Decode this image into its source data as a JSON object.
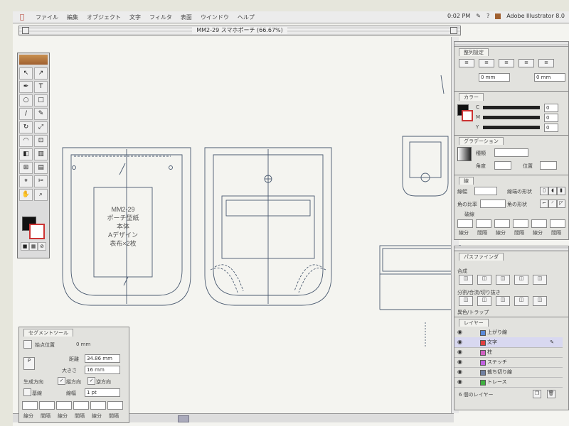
{
  "menubar": {
    "items": [
      "ファイル",
      "編集",
      "オブジェクト",
      "文字",
      "フィルタ",
      "表面",
      "ウインドウ",
      "ヘルプ"
    ],
    "clock": "0:02 PM",
    "app_name": "Adobe Illustrator 8.0"
  },
  "document": {
    "title": "MM2-29 スマホポーチ (66.67%)"
  },
  "drawing": {
    "piece1_lines": [
      "MM2-29",
      "ポーチ型紙",
      "本体",
      "Aデザイン",
      "表布×2枚"
    ]
  },
  "panels": {
    "align": {
      "tab": "整列設定",
      "value1": "0 mm",
      "value2": "0 mm"
    },
    "color": {
      "tab": "カラー",
      "c_label": "C",
      "m_label": "M",
      "y_label": "Y",
      "c_val": "0",
      "m_val": "0",
      "y_val": "0"
    },
    "gradient": {
      "tab": "グラデーション",
      "type_label": "種類",
      "angle_label": "角度",
      "position_label": "位置"
    },
    "stroke": {
      "tab": "線",
      "weight_label": "線幅",
      "miter_label": "角の比率",
      "cap_label": "線端の形状",
      "corner_label": "角の形状",
      "dash_label": "破線",
      "field_labels": [
        "線分",
        "間隔",
        "線分",
        "間隔",
        "線分",
        "間隔"
      ]
    },
    "pathfinder": {
      "tab": "パスファインダ",
      "row1_label": "合成",
      "row2_label": "分割/合流/切り抜き",
      "row3_label": "異色/トラップ"
    },
    "layers": {
      "tab": "レイヤー",
      "rows": [
        {
          "name": "上がり線",
          "color": "#5a8ad8"
        },
        {
          "name": "文字",
          "color": "#e04040"
        },
        {
          "name": "柱",
          "color": "#d060c0"
        },
        {
          "name": "ステッチ",
          "color": "#c060e0"
        },
        {
          "name": "裁ち切り線",
          "color": "#7080a0"
        },
        {
          "name": "トレース",
          "color": "#40b040"
        }
      ],
      "footer": "6 個のレイヤー"
    },
    "segment": {
      "tab": "セグメントツール",
      "start_label": "始点位置",
      "start_value": "0 mm",
      "distance_label": "距離",
      "distance_value": "34.86 mm",
      "size_label": "大きさ",
      "size_value": "16 mm",
      "direction_label": "生成方向",
      "dir_vertical": "縦方向",
      "dir_horizontal": "逆方向",
      "group_label": "基線",
      "weight_label": "線幅",
      "weight_value": "1 pt",
      "field_labels": [
        "線分",
        "間隔",
        "線分",
        "間隔",
        "線分",
        "間隔"
      ]
    }
  },
  "colors": {
    "accent": "#a06030",
    "paper": "#f4f4f0",
    "line": "#4a5a70"
  }
}
